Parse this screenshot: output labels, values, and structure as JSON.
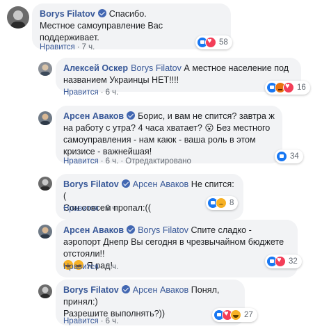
{
  "comments": [
    {
      "author": "Borys Filatov",
      "verified": true,
      "mention": "",
      "text": "Спасибо.",
      "text2": "Местное самоуправление Вас поддерживает.",
      "like_label": "Нравится",
      "time": "7 ч.",
      "edited": "",
      "reactions": [
        "like",
        "love"
      ],
      "reaction_count": "58"
    },
    {
      "author": "Алексей Оскер",
      "verified": false,
      "mention": "Borys Filatov",
      "text": "А местное население под названием Украинцы НЕТ!!!!",
      "like_label": "Нравится",
      "time": "6 ч.",
      "edited": "",
      "reactions": [
        "like",
        "angry",
        "love"
      ],
      "reaction_count": "16"
    },
    {
      "author": "Арсен Аваков",
      "verified": true,
      "mention": "",
      "text": "Борис, и вам не спится? завтра ж на работу с утра? 4 часа хватает? 😮 Без местного самоуправления - нам каюк - ваша роль в этом кризисе - важнейшая!",
      "like_label": "Нравится",
      "time": "6 ч.",
      "edited": "Отредактировано",
      "reactions": [
        "like"
      ],
      "reaction_count": "34"
    },
    {
      "author": "Borys Filatov",
      "verified": true,
      "mention": "Арсен Аваков",
      "text": "Не спится:(",
      "text2": "Сон совсем пропал:((",
      "like_label": "Нравится",
      "time": "6 ч.",
      "edited": "",
      "reactions": [
        "like",
        "sad"
      ],
      "reaction_count": "8"
    },
    {
      "author": "Арсен Аваков",
      "verified": true,
      "mention": "Borys Filatov",
      "text": "Спите сладко - аэропорт Днепр Вы сегодня в чрезвычайном бюджете отстояли!!",
      "text2": "Я рад!",
      "like_label": "Нравится",
      "time": "6 ч.",
      "edited": "",
      "reactions": [
        "like",
        "love"
      ],
      "reaction_count": "32"
    },
    {
      "author": "Borys Filatov",
      "verified": true,
      "mention": "Арсен Аваков",
      "text": "Понял, принял:)",
      "text2": "Разрешите выполнять?))",
      "like_label": "Нравится",
      "time": "6 ч.",
      "edited": "",
      "reactions": [
        "like",
        "love",
        "haha"
      ],
      "reaction_count": "27"
    }
  ],
  "sep": "·"
}
